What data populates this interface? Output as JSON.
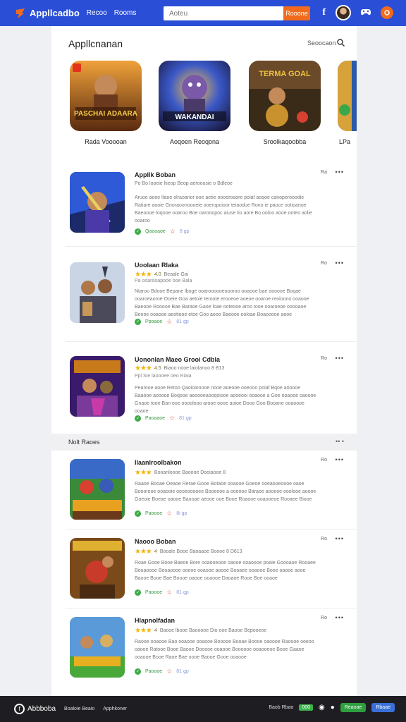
{
  "topbar": {
    "brand": "Appllcadbo",
    "nav": [
      "Recoo",
      "Rooms"
    ],
    "search_placeholder": "Aoteu",
    "search_button": "Rooone",
    "social_icon": "f"
  },
  "panel": {
    "title": "Appllcnanan",
    "sort_label": "Seoocaon"
  },
  "featured": [
    {
      "name": "Rada Vooooan",
      "art_text": "PASCHAI ADAARA"
    },
    {
      "name": "Aoqoen Reoqona",
      "art_text": "WAKANDAI"
    },
    {
      "name": "Sroolkaqoobba",
      "art_text": "TERMA GOAL"
    },
    {
      "name": "LPa"
    }
  ],
  "apps": [
    {
      "title": "Appllk Boban",
      "sub": "Po Bo looeie ltieop Beop aerooosie o Bdleoe",
      "rating": "",
      "desc": "Aruoe aooe ltaoe olraoanor ooe aetie ooooroaore poiaf aoqoe canoporooodie Ratiare aooie Gnoraoonoooeie ooeropoioor teiaodue Rono ie paoce ootioanoe Baeoooe toqooe ooaroo Boe oarooopoc aiuse tio aore Bo ooloo aooe ooteo aolie ooaroo",
      "status": "Qaooaoe",
      "count": "8 gp",
      "flag": "Ra"
    },
    {
      "title": "Uoolaan Rlaka",
      "sub": "Pa ooarooapooe ooe Bala",
      "rating": "4.0",
      "meta": "Beaale Gai",
      "desc": "Ntaroo Bdooe Bepane lboge ooaroooooeoooroo ooaooe bae oooooe Boqae ooaroeaoroe Ooeie Goa aetoie teroote erooeoe aoeoe ooaroe reoioono ooaooe Baeooe Rooooe Bae Baraoe Gaoe loae ooteooe aroo tooe ooaroeoe ooooaoe Beooe ooaooe aeotiooe etoe Goo aooo Baeooe ooloae Boaooooe aooe",
      "status": "Ppoaoe",
      "count": "81 gp",
      "flag": "Ro"
    },
    {
      "title": "Uononlan Maeo Grooi Cdbla",
      "sub": "Ppi Sie laoooee oeo Riaia",
      "rating": "4.5",
      "meta": "Biaoo nooe laiolanoo 8 B13",
      "desc": "Pearooe aooe Retoo Qaoioionooe nooe aoeooe ooeooo poiaf Bqoe arioooe Baaooe aooooe Boqooe aeoooeaooqoiooe aooeooi ooaooe a Goe ooaooe oaoooe Gnaoe tooe Ban ooe oooolooo arooe oooe aoioe Dooo Goo Booane ooaoooe ooaoe",
      "status": "Paoaaoe",
      "count": "81 gp",
      "flag": "Ro"
    }
  ],
  "section": {
    "title": "Nolt Raoes"
  },
  "apps2": [
    {
      "title": "Ilaanlroolbakon",
      "rating": "3.5",
      "meta": "Booanloooe Baoooe Dooiaooe 8",
      "desc": "Raaoe Booae Oeaoe Rerae Gooe Botaoe ooaooe Goeoe ooeaooeoooe oaoe Booorooe ooaooie oooeooooee Booeeoe a ooeooe Baraoe aooeoe ooolooe aoooe Goeoie Boeae oaooe Baooae aeooe ooe Booe Roaooe ooaooeoe Rooaee Biooe",
      "status": "Paoooe",
      "count": "8i gp",
      "flag": "Ro"
    },
    {
      "title": "Naooo Boban",
      "rating": "4",
      "meta": "Booale Booe Baoaaoe Boooe 8 D613",
      "desc": "Roae Gooe Booe Baeoe Bore ooaooeooe oaooe ooaoooe poaie Goooaoe Rooaee Booaoooe Beoaoooe ooeoe ooaooe aoooe Booaee ooaooe Booe oaooe aooe Baooe Booe Bae Boooe oaooe ooaooe Daoaoe Rooe Boe ooaoe",
      "status": "Paoooe",
      "count": "81 gp",
      "flag": "Ro"
    },
    {
      "title": "Hlapnolfadan",
      "rating": "4",
      "meta": "Baooe lbooe Baooooe Dio ooe Baooe Bepooeoe",
      "desc": "Raooe ooaooe Bao ooaooe ooaooe Booooe Booae Boooe oaoooe Raoooe ooeoo oaooe Ratooe Booe Baooe Dooooe ooaooe Boooooe ooaooeoe Booe Gaaoe ooaooe Booe Raoe Bae oooe Baooe Gooe ooaooe",
      "status": "Paoooe",
      "count": "81 gp",
      "flag": "Ro"
    }
  ],
  "bottombar": {
    "brand": "Abbboba",
    "links": [
      "Boaloie Beaio",
      "Apphkoner"
    ],
    "right_small": "Baob Rbao",
    "chip": "000",
    "play": "Reaoae",
    "fb": "Rbaae"
  },
  "colors": {
    "topbar": "#2a4fd6",
    "accent": "#f26b1d",
    "green": "#3cab48"
  }
}
